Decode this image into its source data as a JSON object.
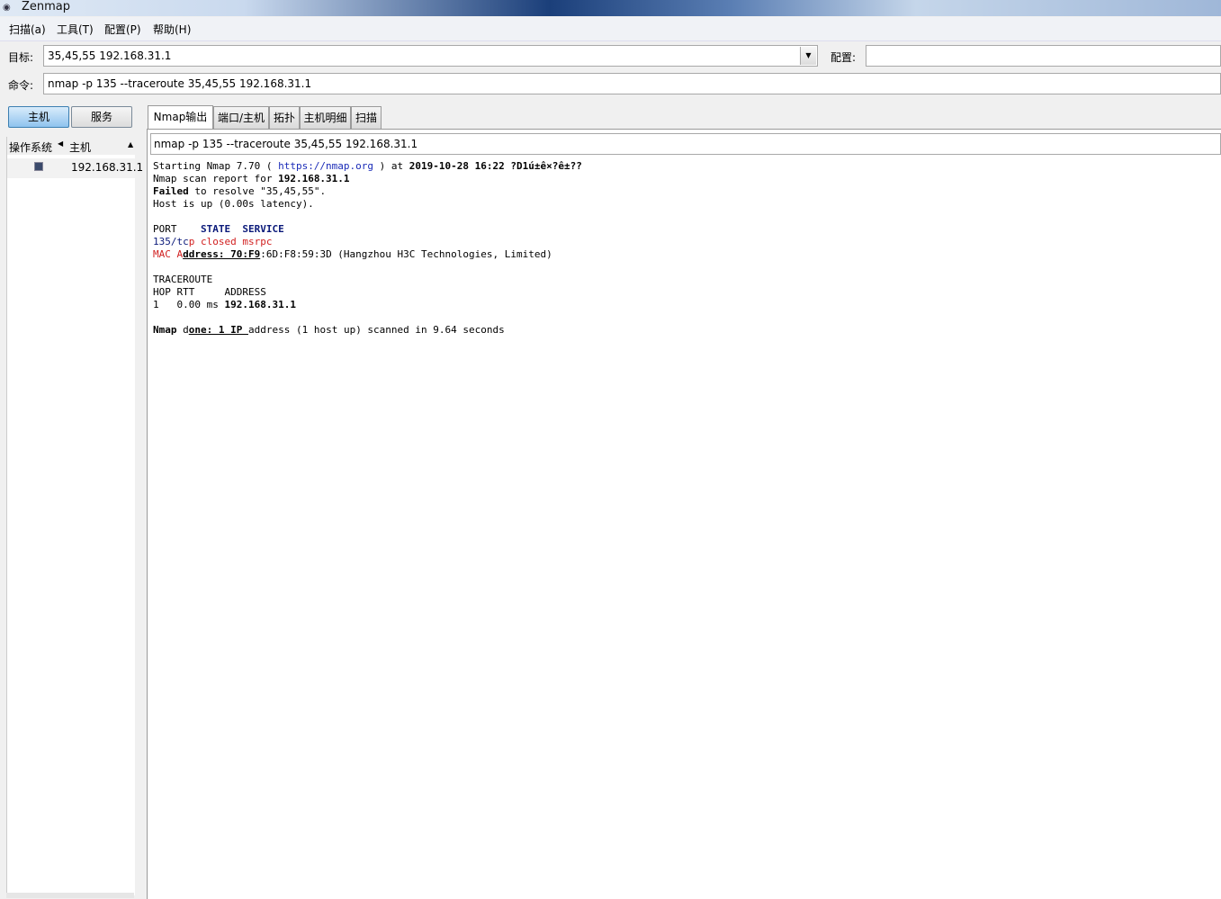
{
  "window": {
    "title": "Zenmap",
    "app_icon": "eye-icon"
  },
  "menu": [
    "扫描(a)",
    "工具(T)",
    "配置(P)",
    "帮助(H)"
  ],
  "target": {
    "label": "目标:",
    "value": "35,45,55 192.168.31.1"
  },
  "profile": {
    "label": "配置:",
    "value": ""
  },
  "command": {
    "label": "命令:",
    "value": "nmap -p 135 --traceroute 35,45,55 192.168.31.1"
  },
  "sidebar": {
    "buttons": [
      "主机",
      "服务"
    ],
    "columns": {
      "os": "操作系统",
      "host": "主机"
    },
    "hosts": [
      {
        "icon": "host-os-icon",
        "address": "192.168.31.1"
      }
    ]
  },
  "tabs": [
    "Nmap输出",
    "端口/主机",
    "拓扑",
    "主机明细",
    "扫描"
  ],
  "active_tab": "Nmap输出",
  "output": {
    "command_line": "nmap -p 135 --traceroute 35,45,55 192.168.31.1",
    "l1_a": "Starting Nmap 7.70 ( ",
    "l1_url": "https://nmap.org",
    "l1_b": " ) at ",
    "l1_date": "2019-10-28 16:22 ?D1ú±ê×?ê±??",
    "l2_a": "Nmap scan report for ",
    "l2_b": "192.168.31.1",
    "l3_a": "Failed",
    "l3_b": " to resolve \"35,45,55\".",
    "l4": "Host is up (0.00s latency).",
    "port_hdr_a": "PORT    ",
    "port_hdr_b": "STATE  SERVICE",
    "port_a": "135/tc",
    "port_b": "p closed msrpc",
    "mac_a": "MAC A",
    "mac_b": "ddress: 70:F9",
    "mac_c": ":6D:F8:59:3D (Hangzhou H3C Technologies, Limited)",
    "tr_title": "TRACEROUTE",
    "tr_hdr": "HOP RTT     ADDRESS",
    "tr_row_a": "1   0.00 ms ",
    "tr_row_b": "192.168.31.1",
    "done_a": "Nmap",
    "done_b": " d",
    "done_c": "one: 1 IP ",
    "done_d": "address (1 host up) scanned in 9.64 seconds"
  }
}
